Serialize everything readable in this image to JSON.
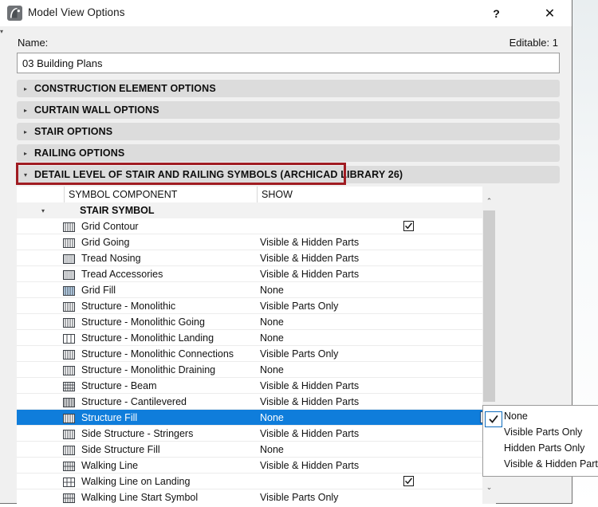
{
  "window": {
    "title": "Model View Options",
    "app_icon": "archicad-logo-icon",
    "help_label": "?",
    "close_label": "✕"
  },
  "name_field": {
    "label": "Name:",
    "value": "03 Building Plans",
    "editable_label": "Editable: 1"
  },
  "accordions": [
    {
      "label": "CONSTRUCTION ELEMENT OPTIONS",
      "expanded": false,
      "triangle": "▸"
    },
    {
      "label": "CURTAIN WALL OPTIONS",
      "expanded": false,
      "triangle": "▸"
    },
    {
      "label": "STAIR OPTIONS",
      "expanded": false,
      "triangle": "▸"
    },
    {
      "label": "RAILING OPTIONS",
      "expanded": false,
      "triangle": "▸"
    },
    {
      "label": "DETAIL LEVEL OF STAIR AND RAILING SYMBOLS (ARCHICAD LIBRARY 26)",
      "expanded": true,
      "triangle": "▾"
    }
  ],
  "highlight": {
    "color": "#a01c22"
  },
  "table": {
    "columns": [
      "",
      "SYMBOL COMPONENT",
      "SHOW"
    ],
    "group": {
      "label": "STAIR SYMBOL",
      "triangle": "▾"
    },
    "rows": [
      {
        "icon": "grid-contour-hatch-icon",
        "name": "Grid Contour",
        "show": "",
        "checkbox": true,
        "selected": false
      },
      {
        "icon": "grid-going-hatch-icon",
        "name": "Grid Going",
        "show": "Visible & Hidden Parts",
        "checkbox": false,
        "selected": false
      },
      {
        "icon": "tread-nosing-hatch-icon",
        "name": "Tread Nosing",
        "show": "Visible & Hidden Parts",
        "checkbox": false,
        "selected": false
      },
      {
        "icon": "tread-accessories-hatch-icon",
        "name": "Tread Accessories",
        "show": "Visible & Hidden Parts",
        "checkbox": false,
        "selected": false
      },
      {
        "icon": "grid-fill-hatch-icon",
        "name": "Grid Fill",
        "show": "None",
        "checkbox": false,
        "selected": false
      },
      {
        "icon": "structure-monolithic-hatch-icon",
        "name": "Structure - Monolithic",
        "show": "Visible Parts Only",
        "checkbox": false,
        "selected": false
      },
      {
        "icon": "structure-monolithic-going-hatch-icon",
        "name": "Structure - Monolithic Going",
        "show": "None",
        "checkbox": false,
        "selected": false
      },
      {
        "icon": "structure-monolithic-landing-hatch-icon",
        "name": "Structure - Monolithic Landing",
        "show": "None",
        "checkbox": false,
        "selected": false
      },
      {
        "icon": "structure-monolithic-connections-hatch-icon",
        "name": "Structure - Monolithic Connections",
        "show": "Visible Parts Only",
        "checkbox": false,
        "selected": false
      },
      {
        "icon": "structure-monolithic-draining-hatch-icon",
        "name": "Structure - Monolithic Draining",
        "show": "None",
        "checkbox": false,
        "selected": false
      },
      {
        "icon": "structure-beam-hatch-icon",
        "name": "Structure - Beam",
        "show": "Visible & Hidden Parts",
        "checkbox": false,
        "selected": false
      },
      {
        "icon": "structure-cantilevered-hatch-icon",
        "name": "Structure - Cantilevered",
        "show": "Visible & Hidden Parts",
        "checkbox": false,
        "selected": false
      },
      {
        "icon": "structure-fill-hatch-icon",
        "name": "Structure Fill",
        "show": "None",
        "checkbox": false,
        "selected": true
      },
      {
        "icon": "side-structure-stringers-hatch-icon",
        "name": "Side Structure - Stringers",
        "show": "Visible & Hidden Parts",
        "checkbox": false,
        "selected": false
      },
      {
        "icon": "side-structure-fill-hatch-icon",
        "name": "Side Structure Fill",
        "show": "None",
        "checkbox": false,
        "selected": false
      },
      {
        "icon": "walking-line-hatch-icon",
        "name": "Walking Line",
        "show": "Visible & Hidden Parts",
        "checkbox": false,
        "selected": false
      },
      {
        "icon": "walking-line-on-landing-hatch-icon",
        "name": "Walking Line on Landing",
        "show": "",
        "checkbox": true,
        "selected": false
      },
      {
        "icon": "walking-line-start-symbol-hatch-icon",
        "name": "Walking Line Start Symbol",
        "show": "Visible Parts Only",
        "checkbox": false,
        "selected": false
      }
    ],
    "selected_row_button": "▸"
  },
  "scrollbar": {
    "up_arrow": "⌃",
    "down_arrow": "⌄"
  },
  "popup_menu": {
    "items": [
      {
        "label": "None",
        "checked": true
      },
      {
        "label": "Visible Parts Only",
        "checked": false
      },
      {
        "label": "Hidden Parts Only",
        "checked": false
      },
      {
        "label": "Visible & Hidden Parts",
        "checked": false
      }
    ]
  }
}
